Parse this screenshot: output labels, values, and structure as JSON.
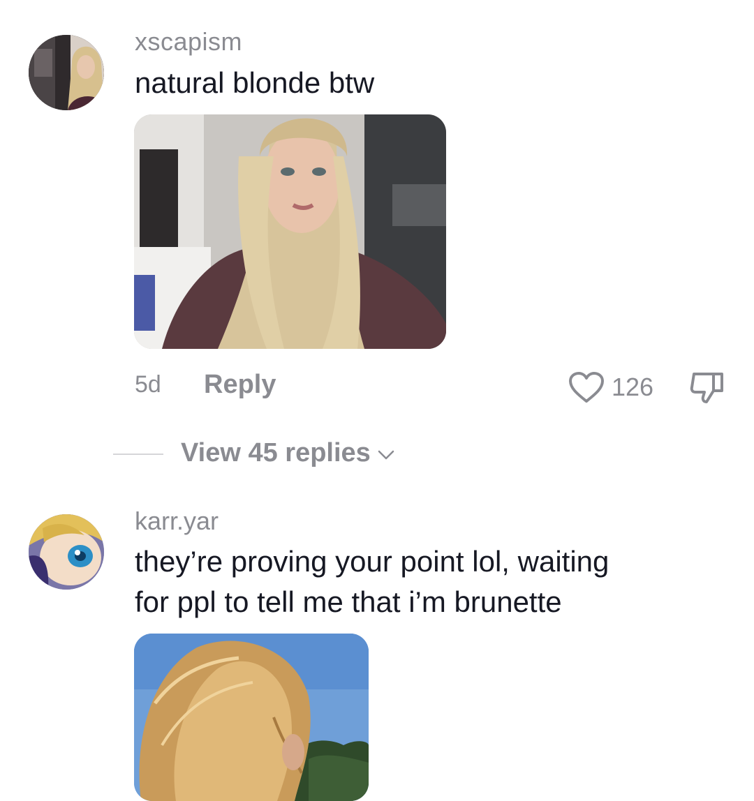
{
  "comments": [
    {
      "username": "xscapism",
      "text": "natural blonde btw",
      "time": "5d",
      "reply_label": "Reply",
      "likes": "126",
      "view_replies_label": "View 45 replies"
    },
    {
      "username": "karr.yar",
      "text_line1": "they’re proving your point lol, waiting",
      "text_line2": "for ppl to tell me that i’m brunette"
    }
  ],
  "colors": {
    "primary_text": "#161823",
    "secondary_text": "#8a8b91",
    "divider": "#d5d5d8"
  },
  "icons": [
    "heart-icon",
    "dislike-icon",
    "chevron-down-icon"
  ]
}
